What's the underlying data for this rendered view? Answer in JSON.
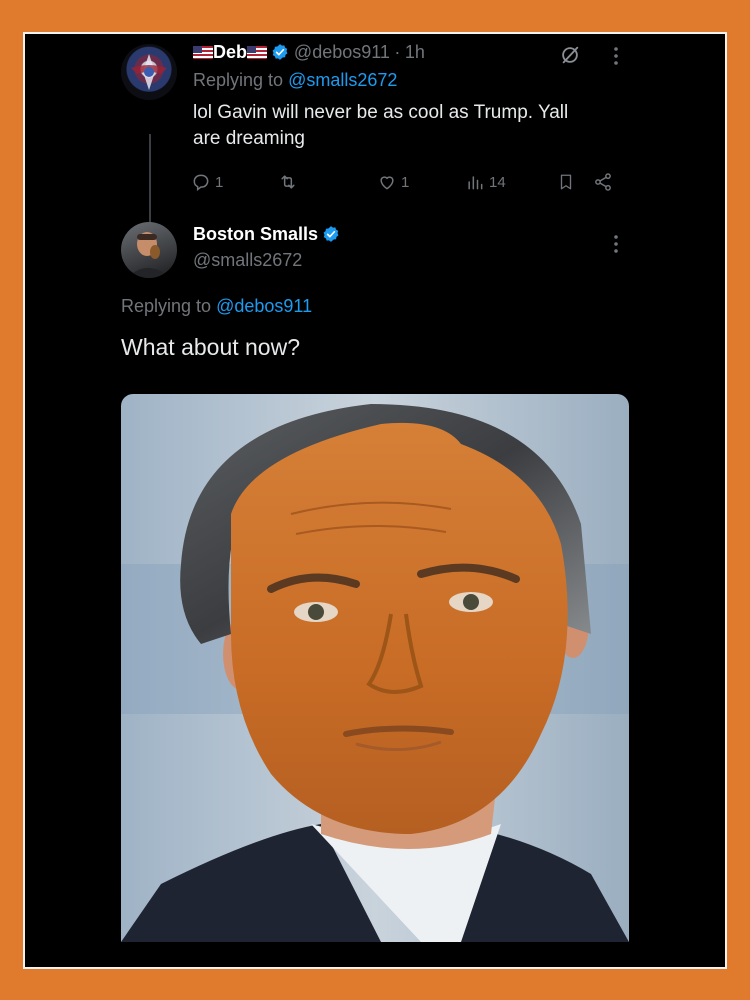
{
  "tweet1": {
    "display_name": "Deb",
    "handle": "@debos911",
    "separator": "·",
    "time": "1h",
    "replying_prefix": "Replying to",
    "replying_to": "@smalls2672",
    "text_line1": "lol Gavin will never be as cool as Trump. Yall",
    "text_line2": "are dreaming",
    "replies": "1",
    "likes": "1",
    "views": "14"
  },
  "tweet2": {
    "display_name": "Boston Smalls",
    "handle": "@smalls2672",
    "replying_prefix": "Replying to",
    "replying_to": "@debos911",
    "text": "What about now?"
  },
  "colors": {
    "frame_border": "#e07a2c",
    "background": "#000000",
    "link": "#1d9bf0",
    "muted": "#71767b",
    "verified": "#1d9bf0"
  },
  "icons": [
    "flag-us-icon",
    "verified-icon",
    "grok-icon",
    "more-icon",
    "reply-icon",
    "repost-icon",
    "like-icon",
    "views-icon",
    "bookmark-icon",
    "share-icon"
  ]
}
